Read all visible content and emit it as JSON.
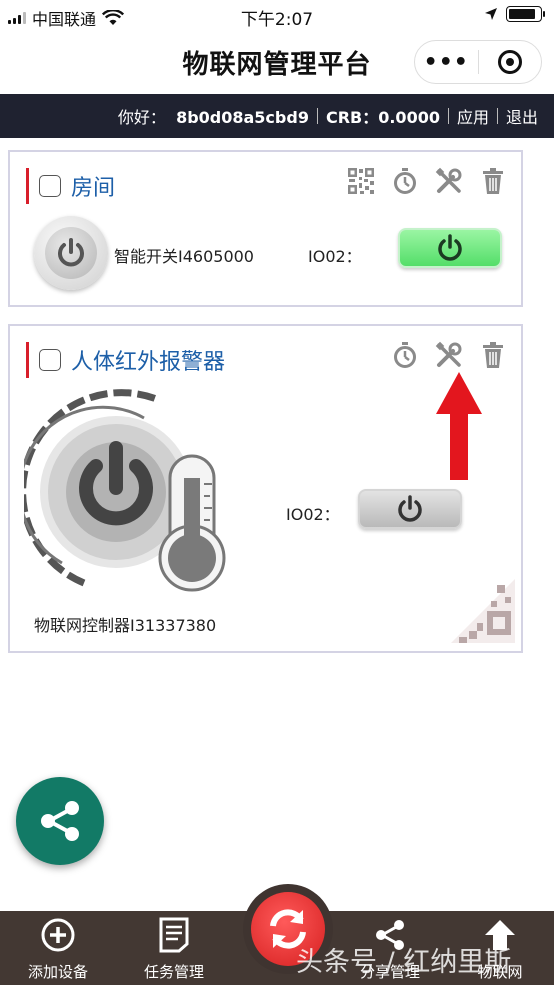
{
  "status_bar": {
    "carrier": "中国联通",
    "time": "下午2:07",
    "battery_level": 0.85
  },
  "nav": {
    "title": "物联网管理平台",
    "more": "•••"
  },
  "info_bar": {
    "greeting": "你好：",
    "user_id": "8b0d08a5cbd9",
    "crb_label": "CRB：",
    "crb_value": "0.0000",
    "apps": "应用",
    "logout": "退出"
  },
  "cards": [
    {
      "title": "房间",
      "checked": false,
      "tools": [
        "qr-code-icon",
        "timer-icon",
        "settings-tools-icon",
        "delete-icon"
      ],
      "device": {
        "name": "智能开关I4605000",
        "io_label": "IO02：",
        "switch_state": "on"
      }
    },
    {
      "title": "人体红外报警器",
      "checked": false,
      "tools": [
        "timer-icon",
        "settings-tools-icon",
        "delete-icon"
      ],
      "device": {
        "name": "物联网控制器I31337380",
        "io_label": "IO02：",
        "switch_state": "off"
      }
    }
  ],
  "bottom_bar": {
    "tabs": [
      {
        "label": "添加设备",
        "icon": "add-circle-icon"
      },
      {
        "label": "任务管理",
        "icon": "task-list-icon"
      },
      {
        "label": "分享管理",
        "icon": "share-icon"
      },
      {
        "label": "物联网",
        "icon": "home-upload-icon"
      }
    ]
  },
  "watermark": "头条号 / 红纳里斯",
  "colors": {
    "info_bar_bg": "#1f2230",
    "title_blue": "#1d5fa8",
    "accent_red": "#d81e2a",
    "bottom_bar_bg": "#433833",
    "share_fab": "#127a66",
    "switch_on": "#54de69"
  }
}
